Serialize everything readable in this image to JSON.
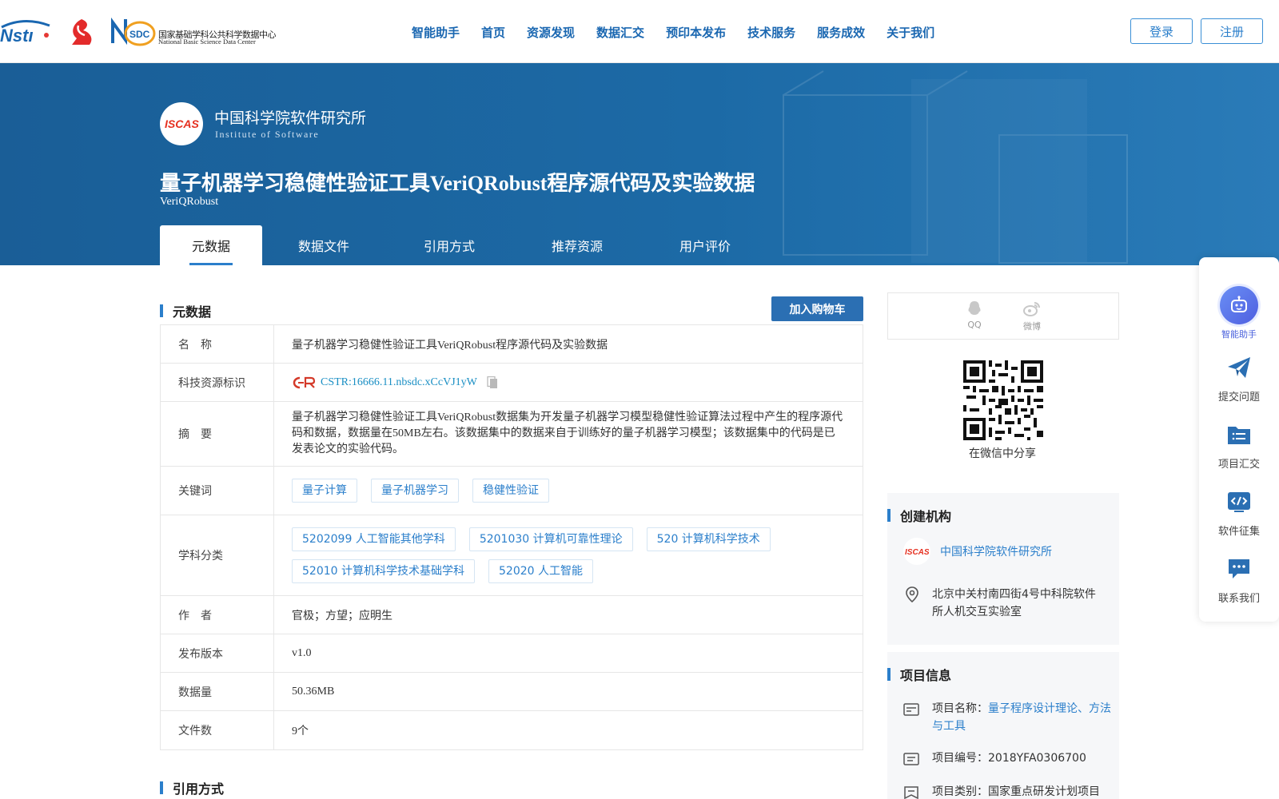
{
  "header": {
    "logo_nsdc_cn": "国家基础学科公共科学数据中心",
    "logo_nsdc_en": "National Basic Science Data Center",
    "nav": [
      "智能助手",
      "首页",
      "资源发现",
      "数据汇交",
      "预印本发布",
      "技术服务",
      "服务成效",
      "关于我们"
    ],
    "login": "登录",
    "register": "注册"
  },
  "banner": {
    "org_name": "中国科学院软件研究所",
    "org_en": "Institute of Software",
    "org_logo_text": "ISCAS",
    "title": "量子机器学习稳健性验证工具VeriQRobust程序源代码及实验数据",
    "subtitle": "VeriQRobust",
    "tabs": [
      "元数据",
      "数据文件",
      "引用方式",
      "推荐资源",
      "用户评价"
    ],
    "active_tab": "元数据"
  },
  "metadata": {
    "section_title": "元数据",
    "cart_button": "加入购物车",
    "rows": {
      "name": {
        "label": "名　称",
        "value": "量子机器学习稳健性验证工具VeriQRobust程序源代码及实验数据"
      },
      "cstr": {
        "label": "科技资源标识",
        "value": "CSTR:16666.11.nbsdc.xCcVJ1yW"
      },
      "abstract": {
        "label": "摘　要",
        "value": "量子机器学习稳健性验证工具VeriQRobust数据集为开发量子机器学习模型稳健性验证算法过程中产生的程序源代码和数据，数据量在50MB左右。该数据集中的数据来自于训练好的量子机器学习模型；该数据集中的代码是已发表论文的实验代码。"
      },
      "keywords": {
        "label": "关键词",
        "tags": [
          "量子计算",
          "量子机器学习",
          "稳健性验证"
        ]
      },
      "subjects": {
        "label": "学科分类",
        "tags": [
          "5202099 人工智能其他学科",
          "5201030 计算机可靠性理论",
          "520 计算机科学技术",
          "52010 计算机科学技术基础学科",
          "52020 人工智能"
        ]
      },
      "authors": {
        "label": "作　者",
        "value": "官极；方望；应明生"
      },
      "version": {
        "label": "发布版本",
        "value": "v1.0"
      },
      "size": {
        "label": "数据量",
        "value": "50.36MB"
      },
      "files": {
        "label": "文件数",
        "value": "9个"
      }
    }
  },
  "citation": {
    "section_title": "引用方式"
  },
  "share": {
    "qq": "QQ",
    "weibo": "微博",
    "wechat_text": "在微信中分享"
  },
  "creator": {
    "title": "创建机构",
    "name": "中国科学院软件研究所",
    "address": "北京中关村南四街4号中科院软件所人机交互实验室"
  },
  "project": {
    "title": "项目信息",
    "name_label": "项目名称：",
    "name_value": "量子程序设计理论、方法与工具",
    "code_label": "项目编号：",
    "code_value": "2018YFA0306700",
    "type_label": "项目类别：",
    "type_value": "国家重点研发计划项目"
  },
  "float_bar": [
    "智能助手",
    "提交问题",
    "项目汇交",
    "软件征集",
    "联系我们"
  ],
  "colors": {
    "brand": "#1a67b1",
    "banner": "#1c6aa6",
    "accent": "#2b7fcb"
  }
}
